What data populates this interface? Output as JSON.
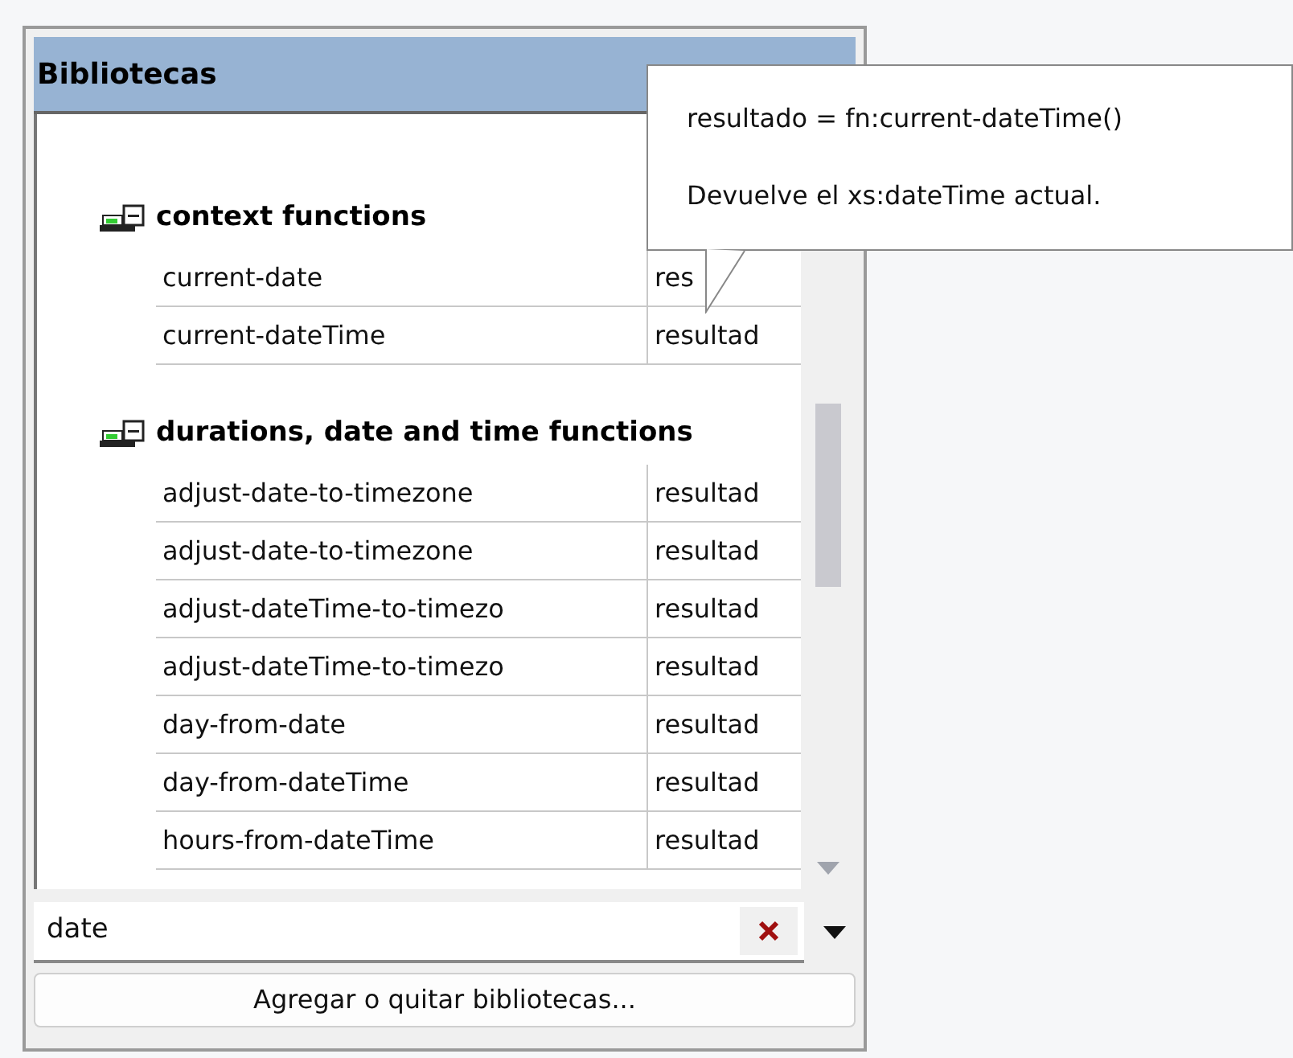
{
  "panel": {
    "title": "Bibliotecas"
  },
  "groups": [
    {
      "name": "context functions",
      "expanded": true,
      "functions": [
        {
          "name": "current-date",
          "result": "res"
        },
        {
          "name": "current-dateTime",
          "result": "resultad"
        }
      ]
    },
    {
      "name": "durations, date and time functions",
      "expanded": true,
      "functions": [
        {
          "name": "adjust-date-to-timezone",
          "result": "resultad"
        },
        {
          "name": "adjust-date-to-timezone",
          "result": "resultad"
        },
        {
          "name": "adjust-dateTime-to-timezo",
          "result": "resultad"
        },
        {
          "name": "adjust-dateTime-to-timezo",
          "result": "resultad"
        },
        {
          "name": "day-from-date",
          "result": "resultad"
        },
        {
          "name": "day-from-dateTime",
          "result": "resultad"
        },
        {
          "name": "hours-from-dateTime",
          "result": "resultad"
        }
      ]
    }
  ],
  "search": {
    "value": "date"
  },
  "add_button": "Agregar o quitar bibliotecas...",
  "tooltip": {
    "signature": "resultado = fn:current-dateTime()",
    "description": "Devuelve el xs:dateTime actual."
  }
}
